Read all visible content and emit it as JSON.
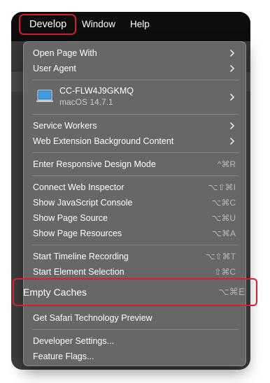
{
  "menubar": {
    "items": [
      {
        "label": "Develop"
      },
      {
        "label": "Window"
      },
      {
        "label": "Help"
      }
    ]
  },
  "menu": {
    "open_page_with": "Open Page With",
    "user_agent": "User Agent",
    "device": {
      "name": "CC-FLW4J9GKMQ",
      "os": "macOS 14.7.1"
    },
    "service_workers": "Service Workers",
    "web_extension_background_content": "Web Extension Background Content",
    "responsive_design_mode": {
      "label": "Enter Responsive Design Mode",
      "shortcut": "^⌘R"
    },
    "connect_web_inspector": {
      "label": "Connect Web Inspector",
      "shortcut": "⌥⇧⌘I"
    },
    "show_javascript_console": {
      "label": "Show JavaScript Console",
      "shortcut": "⌥⌘C"
    },
    "show_page_source": {
      "label": "Show Page Source",
      "shortcut": "⌥⌘U"
    },
    "show_page_resources": {
      "label": "Show Page Resources",
      "shortcut": "⌥⌘A"
    },
    "start_timeline_recording": {
      "label": "Start Timeline Recording",
      "shortcut": "⌥⇧⌘T"
    },
    "start_element_selection": {
      "label": "Start Element Selection",
      "shortcut": "⇧⌘C"
    },
    "empty_caches": {
      "label": "Empty Caches",
      "shortcut": "⌥⌘E"
    },
    "get_safari_technology_preview": "Get Safari Technology Preview",
    "developer_settings": "Developer Settings...",
    "feature_flags": "Feature Flags..."
  },
  "icons": {
    "submenu": "chevron-right-icon",
    "device": "laptop-icon"
  },
  "colors": {
    "highlight_border": "#d8202a",
    "menu_background": "#676767",
    "menubar_background": "#0d0d0d"
  }
}
